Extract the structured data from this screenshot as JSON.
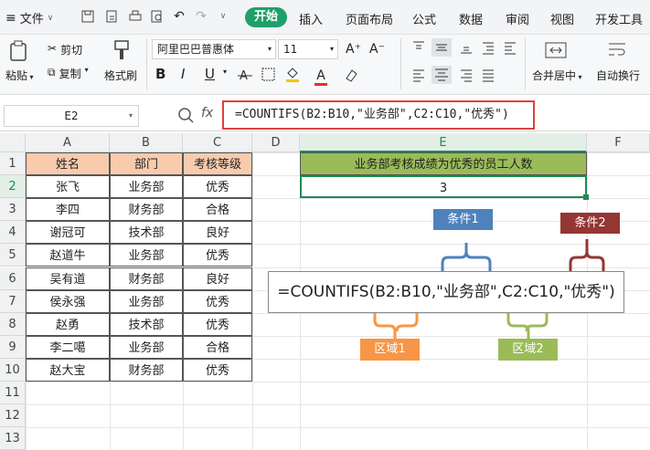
{
  "menu": {
    "file": "文件",
    "tabs": [
      "开始",
      "插入",
      "页面布局",
      "公式",
      "数据",
      "审阅",
      "视图",
      "开发工具"
    ]
  },
  "ribbon": {
    "paste": "粘贴",
    "cut": "剪切",
    "copy": "复制",
    "format_painter": "格式刷",
    "font_name": "阿里巴巴普惠体",
    "font_size": "11",
    "merge": "合并居中",
    "wrap": "自动换行",
    "bold": "B",
    "italic": "I",
    "underline": "U",
    "font_color_letter": "A"
  },
  "formula_bar": {
    "cell_ref": "E2",
    "fx": "fx",
    "formula": "=COUNTIFS(B2:B10,\"业务部\",C2:C10,\"优秀\")"
  },
  "columns": [
    "A",
    "B",
    "C",
    "D",
    "E",
    "F"
  ],
  "rows": [
    "1",
    "2",
    "3",
    "4",
    "5",
    "6",
    "7",
    "8",
    "9",
    "10",
    "11",
    "12",
    "13"
  ],
  "table": {
    "headers": [
      "姓名",
      "部门",
      "考核等级"
    ],
    "rows": [
      [
        "张飞",
        "业务部",
        "优秀"
      ],
      [
        "李四",
        "财务部",
        "合格"
      ],
      [
        "谢冠可",
        "技术部",
        "良好"
      ],
      [
        "赵道牛",
        "业务部",
        "优秀"
      ],
      [
        "吴有道",
        "财务部",
        "良好"
      ],
      [
        "侯永强",
        "业务部",
        "优秀"
      ],
      [
        "赵勇",
        "技术部",
        "优秀"
      ],
      [
        "李二噶",
        "业务部",
        "合格"
      ],
      [
        "赵大宝",
        "财务部",
        "优秀"
      ]
    ]
  },
  "result": {
    "title": "业务部考核成绩为优秀的员工人数",
    "value": "3"
  },
  "annotation": {
    "formula": "=COUNTIFS(B2:B10,\"业务部\",C2:C10,\"优秀\")",
    "cond1": "条件1",
    "cond2": "条件2",
    "range1": "区域1",
    "range2": "区域2"
  },
  "colors": {
    "accent": "#1fa06a",
    "title_bg": "#9bbb59",
    "header_bg": "#f8cbad",
    "cond1": "#4f81bd",
    "cond2": "#943634",
    "range1": "#f79646",
    "range2": "#9bbb59",
    "highlight": "#e04040"
  }
}
